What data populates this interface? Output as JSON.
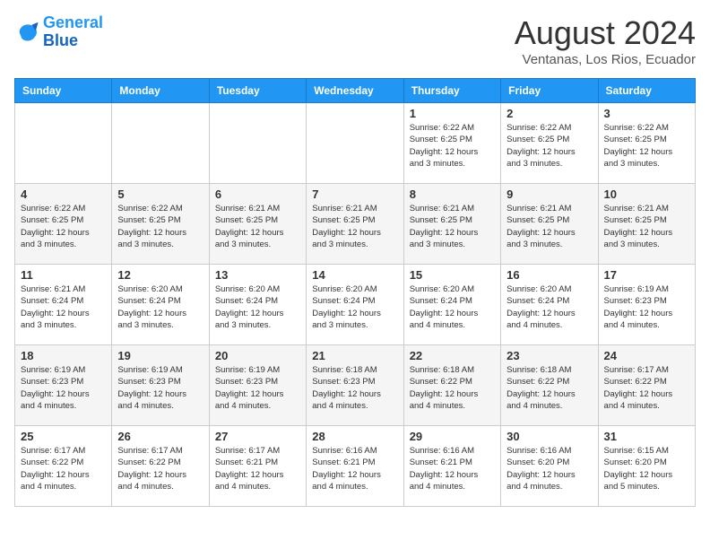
{
  "header": {
    "logo_line1": "General",
    "logo_line2": "Blue",
    "month_year": "August 2024",
    "location": "Ventanas, Los Rios, Ecuador"
  },
  "weekdays": [
    "Sunday",
    "Monday",
    "Tuesday",
    "Wednesday",
    "Thursday",
    "Friday",
    "Saturday"
  ],
  "weeks": [
    [
      {
        "day": "",
        "info": ""
      },
      {
        "day": "",
        "info": ""
      },
      {
        "day": "",
        "info": ""
      },
      {
        "day": "",
        "info": ""
      },
      {
        "day": "1",
        "info": "Sunrise: 6:22 AM\nSunset: 6:25 PM\nDaylight: 12 hours\nand 3 minutes."
      },
      {
        "day": "2",
        "info": "Sunrise: 6:22 AM\nSunset: 6:25 PM\nDaylight: 12 hours\nand 3 minutes."
      },
      {
        "day": "3",
        "info": "Sunrise: 6:22 AM\nSunset: 6:25 PM\nDaylight: 12 hours\nand 3 minutes."
      }
    ],
    [
      {
        "day": "4",
        "info": "Sunrise: 6:22 AM\nSunset: 6:25 PM\nDaylight: 12 hours\nand 3 minutes."
      },
      {
        "day": "5",
        "info": "Sunrise: 6:22 AM\nSunset: 6:25 PM\nDaylight: 12 hours\nand 3 minutes."
      },
      {
        "day": "6",
        "info": "Sunrise: 6:21 AM\nSunset: 6:25 PM\nDaylight: 12 hours\nand 3 minutes."
      },
      {
        "day": "7",
        "info": "Sunrise: 6:21 AM\nSunset: 6:25 PM\nDaylight: 12 hours\nand 3 minutes."
      },
      {
        "day": "8",
        "info": "Sunrise: 6:21 AM\nSunset: 6:25 PM\nDaylight: 12 hours\nand 3 minutes."
      },
      {
        "day": "9",
        "info": "Sunrise: 6:21 AM\nSunset: 6:25 PM\nDaylight: 12 hours\nand 3 minutes."
      },
      {
        "day": "10",
        "info": "Sunrise: 6:21 AM\nSunset: 6:25 PM\nDaylight: 12 hours\nand 3 minutes."
      }
    ],
    [
      {
        "day": "11",
        "info": "Sunrise: 6:21 AM\nSunset: 6:24 PM\nDaylight: 12 hours\nand 3 minutes."
      },
      {
        "day": "12",
        "info": "Sunrise: 6:20 AM\nSunset: 6:24 PM\nDaylight: 12 hours\nand 3 minutes."
      },
      {
        "day": "13",
        "info": "Sunrise: 6:20 AM\nSunset: 6:24 PM\nDaylight: 12 hours\nand 3 minutes."
      },
      {
        "day": "14",
        "info": "Sunrise: 6:20 AM\nSunset: 6:24 PM\nDaylight: 12 hours\nand 3 minutes."
      },
      {
        "day": "15",
        "info": "Sunrise: 6:20 AM\nSunset: 6:24 PM\nDaylight: 12 hours\nand 4 minutes."
      },
      {
        "day": "16",
        "info": "Sunrise: 6:20 AM\nSunset: 6:24 PM\nDaylight: 12 hours\nand 4 minutes."
      },
      {
        "day": "17",
        "info": "Sunrise: 6:19 AM\nSunset: 6:23 PM\nDaylight: 12 hours\nand 4 minutes."
      }
    ],
    [
      {
        "day": "18",
        "info": "Sunrise: 6:19 AM\nSunset: 6:23 PM\nDaylight: 12 hours\nand 4 minutes."
      },
      {
        "day": "19",
        "info": "Sunrise: 6:19 AM\nSunset: 6:23 PM\nDaylight: 12 hours\nand 4 minutes."
      },
      {
        "day": "20",
        "info": "Sunrise: 6:19 AM\nSunset: 6:23 PM\nDaylight: 12 hours\nand 4 minutes."
      },
      {
        "day": "21",
        "info": "Sunrise: 6:18 AM\nSunset: 6:23 PM\nDaylight: 12 hours\nand 4 minutes."
      },
      {
        "day": "22",
        "info": "Sunrise: 6:18 AM\nSunset: 6:22 PM\nDaylight: 12 hours\nand 4 minutes."
      },
      {
        "day": "23",
        "info": "Sunrise: 6:18 AM\nSunset: 6:22 PM\nDaylight: 12 hours\nand 4 minutes."
      },
      {
        "day": "24",
        "info": "Sunrise: 6:17 AM\nSunset: 6:22 PM\nDaylight: 12 hours\nand 4 minutes."
      }
    ],
    [
      {
        "day": "25",
        "info": "Sunrise: 6:17 AM\nSunset: 6:22 PM\nDaylight: 12 hours\nand 4 minutes."
      },
      {
        "day": "26",
        "info": "Sunrise: 6:17 AM\nSunset: 6:22 PM\nDaylight: 12 hours\nand 4 minutes."
      },
      {
        "day": "27",
        "info": "Sunrise: 6:17 AM\nSunset: 6:21 PM\nDaylight: 12 hours\nand 4 minutes."
      },
      {
        "day": "28",
        "info": "Sunrise: 6:16 AM\nSunset: 6:21 PM\nDaylight: 12 hours\nand 4 minutes."
      },
      {
        "day": "29",
        "info": "Sunrise: 6:16 AM\nSunset: 6:21 PM\nDaylight: 12 hours\nand 4 minutes."
      },
      {
        "day": "30",
        "info": "Sunrise: 6:16 AM\nSunset: 6:20 PM\nDaylight: 12 hours\nand 4 minutes."
      },
      {
        "day": "31",
        "info": "Sunrise: 6:15 AM\nSunset: 6:20 PM\nDaylight: 12 hours\nand 5 minutes."
      }
    ]
  ]
}
